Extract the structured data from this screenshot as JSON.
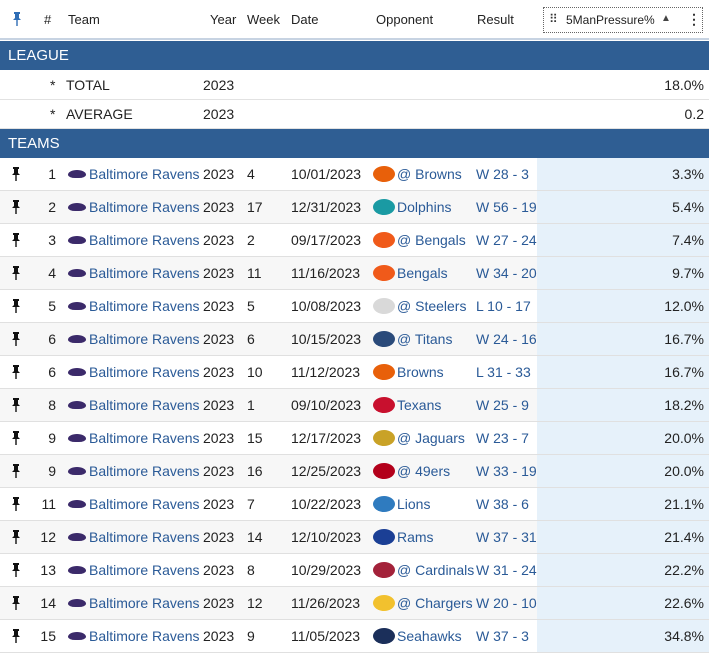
{
  "header": {
    "col_rank": "#",
    "col_team": "Team",
    "col_year": "Year",
    "col_week": "Week",
    "col_date": "Date",
    "col_opponent": "Opponent",
    "col_result": "Result",
    "col_metric": "5ManPressure%"
  },
  "league": {
    "title": "LEAGUE",
    "rows": [
      {
        "marker": "*",
        "label": "TOTAL",
        "year": "2023",
        "value": "18.0%"
      },
      {
        "marker": "*",
        "label": "AVERAGE",
        "year": "2023",
        "value": "0.2"
      }
    ]
  },
  "teams": {
    "title": "TEAMS",
    "rows": [
      {
        "rank": "1",
        "team": "Baltimore Ravens",
        "year": "2023",
        "week": "4",
        "date": "10/01/2023",
        "opponent": "@ Browns",
        "opp_color": "#e8600a",
        "result": "W 28 - 3",
        "value": "3.3%"
      },
      {
        "rank": "2",
        "team": "Baltimore Ravens",
        "year": "2023",
        "week": "17",
        "date": "12/31/2023",
        "opponent": "Dolphins",
        "opp_color": "#1a9aa3",
        "result": "W 56 - 19",
        "value": "5.4%"
      },
      {
        "rank": "3",
        "team": "Baltimore Ravens",
        "year": "2023",
        "week": "2",
        "date": "09/17/2023",
        "opponent": "@ Bengals",
        "opp_color": "#f05a1a",
        "result": "W 27 - 24",
        "value": "7.4%"
      },
      {
        "rank": "4",
        "team": "Baltimore Ravens",
        "year": "2023",
        "week": "11",
        "date": "11/16/2023",
        "opponent": "Bengals",
        "opp_color": "#f05a1a",
        "result": "W 34 - 20",
        "value": "9.7%"
      },
      {
        "rank": "5",
        "team": "Baltimore Ravens",
        "year": "2023",
        "week": "5",
        "date": "10/08/2023",
        "opponent": "@ Steelers",
        "opp_color": "#d9d9d9",
        "result": "L 10 - 17",
        "value": "12.0%"
      },
      {
        "rank": "6",
        "team": "Baltimore Ravens",
        "year": "2023",
        "week": "6",
        "date": "10/15/2023",
        "opponent": "@ Titans",
        "opp_color": "#2a4a7a",
        "result": "W 24 - 16",
        "value": "16.7%"
      },
      {
        "rank": "6",
        "team": "Baltimore Ravens",
        "year": "2023",
        "week": "10",
        "date": "11/12/2023",
        "opponent": "Browns",
        "opp_color": "#e8600a",
        "result": "L 31 - 33",
        "value": "16.7%"
      },
      {
        "rank": "8",
        "team": "Baltimore Ravens",
        "year": "2023",
        "week": "1",
        "date": "09/10/2023",
        "opponent": "Texans",
        "opp_color": "#c8102e",
        "result": "W 25 - 9",
        "value": "18.2%"
      },
      {
        "rank": "9",
        "team": "Baltimore Ravens",
        "year": "2023",
        "week": "15",
        "date": "12/17/2023",
        "opponent": "@ Jaguars",
        "opp_color": "#c9a227",
        "result": "W 23 - 7",
        "value": "20.0%"
      },
      {
        "rank": "9",
        "team": "Baltimore Ravens",
        "year": "2023",
        "week": "16",
        "date": "12/25/2023",
        "opponent": "@ 49ers",
        "opp_color": "#b3001b",
        "result": "W 33 - 19",
        "value": "20.0%"
      },
      {
        "rank": "11",
        "team": "Baltimore Ravens",
        "year": "2023",
        "week": "7",
        "date": "10/22/2023",
        "opponent": "Lions",
        "opp_color": "#2f7bbf",
        "result": "W 38 - 6",
        "value": "21.1%"
      },
      {
        "rank": "12",
        "team": "Baltimore Ravens",
        "year": "2023",
        "week": "14",
        "date": "12/10/2023",
        "opponent": "Rams",
        "opp_color": "#1b3f95",
        "result": "W 37 - 31",
        "value": "21.4%"
      },
      {
        "rank": "13",
        "team": "Baltimore Ravens",
        "year": "2023",
        "week": "8",
        "date": "10/29/2023",
        "opponent": "@ Cardinals",
        "opp_color": "#a3223a",
        "result": "W 31 - 24",
        "value": "22.2%"
      },
      {
        "rank": "14",
        "team": "Baltimore Ravens",
        "year": "2023",
        "week": "12",
        "date": "11/26/2023",
        "opponent": "@ Chargers",
        "opp_color": "#f2c12e",
        "result": "W 20 - 10",
        "value": "22.6%"
      },
      {
        "rank": "15",
        "team": "Baltimore Ravens",
        "year": "2023",
        "week": "9",
        "date": "11/05/2023",
        "opponent": "Seahawks",
        "opp_color": "#1b2f5a",
        "result": "W 37 - 3",
        "value": "34.8%"
      }
    ]
  }
}
